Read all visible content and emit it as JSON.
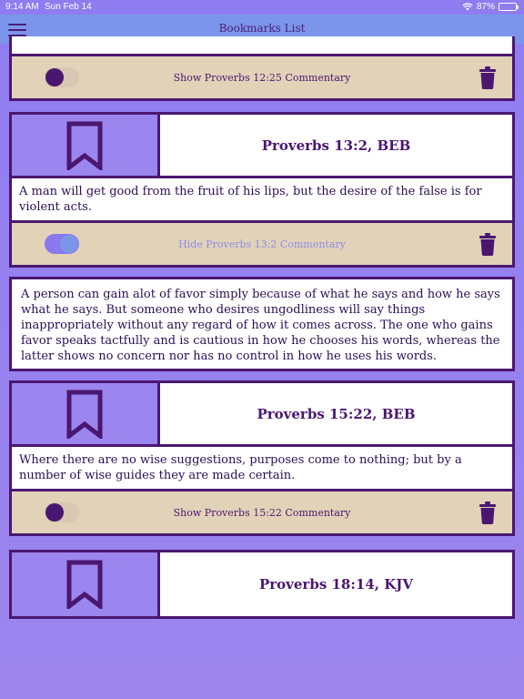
{
  "status": {
    "time": "9:14 AM",
    "date": "Sun Feb 14",
    "battery": "87%"
  },
  "nav": {
    "title": "Bookmarks List",
    "menu_icon": "hamburger-menu-icon"
  },
  "colors": {
    "accent": "#4a1770",
    "bookmark_cell": "#9b85ee",
    "commentary_bar": "#e2d2b8",
    "navbar": "#7b95ea"
  },
  "cards": [
    {
      "commentary_label": "Show Proverbs 12:25 Commentary",
      "toggle_on": false
    },
    {
      "reference": "Proverbs 13:2, BEB",
      "verse": "A man will get good from the fruit of his lips, but the desire of the false is for violent acts.",
      "commentary_label": "Hide Proverbs 13:2 Commentary",
      "toggle_on": true,
      "commentary": "A person can gain alot of favor simply because of what he says and how he says what he says. But someone who desires ungodliness will say things inappropriately without any regard of how it comes across. The one who gains favor speaks tactfully and is cautious in how he chooses his words, whereas the latter shows no concern nor has no control in how he uses his words."
    },
    {
      "reference": "Proverbs 15:22, BEB",
      "verse": "Where there are no wise suggestions, purposes come to nothing; but by a number of wise guides they are made certain.",
      "commentary_label": "Show Proverbs 15:22 Commentary",
      "toggle_on": false
    },
    {
      "reference": "Proverbs 18:14, KJV"
    }
  ]
}
